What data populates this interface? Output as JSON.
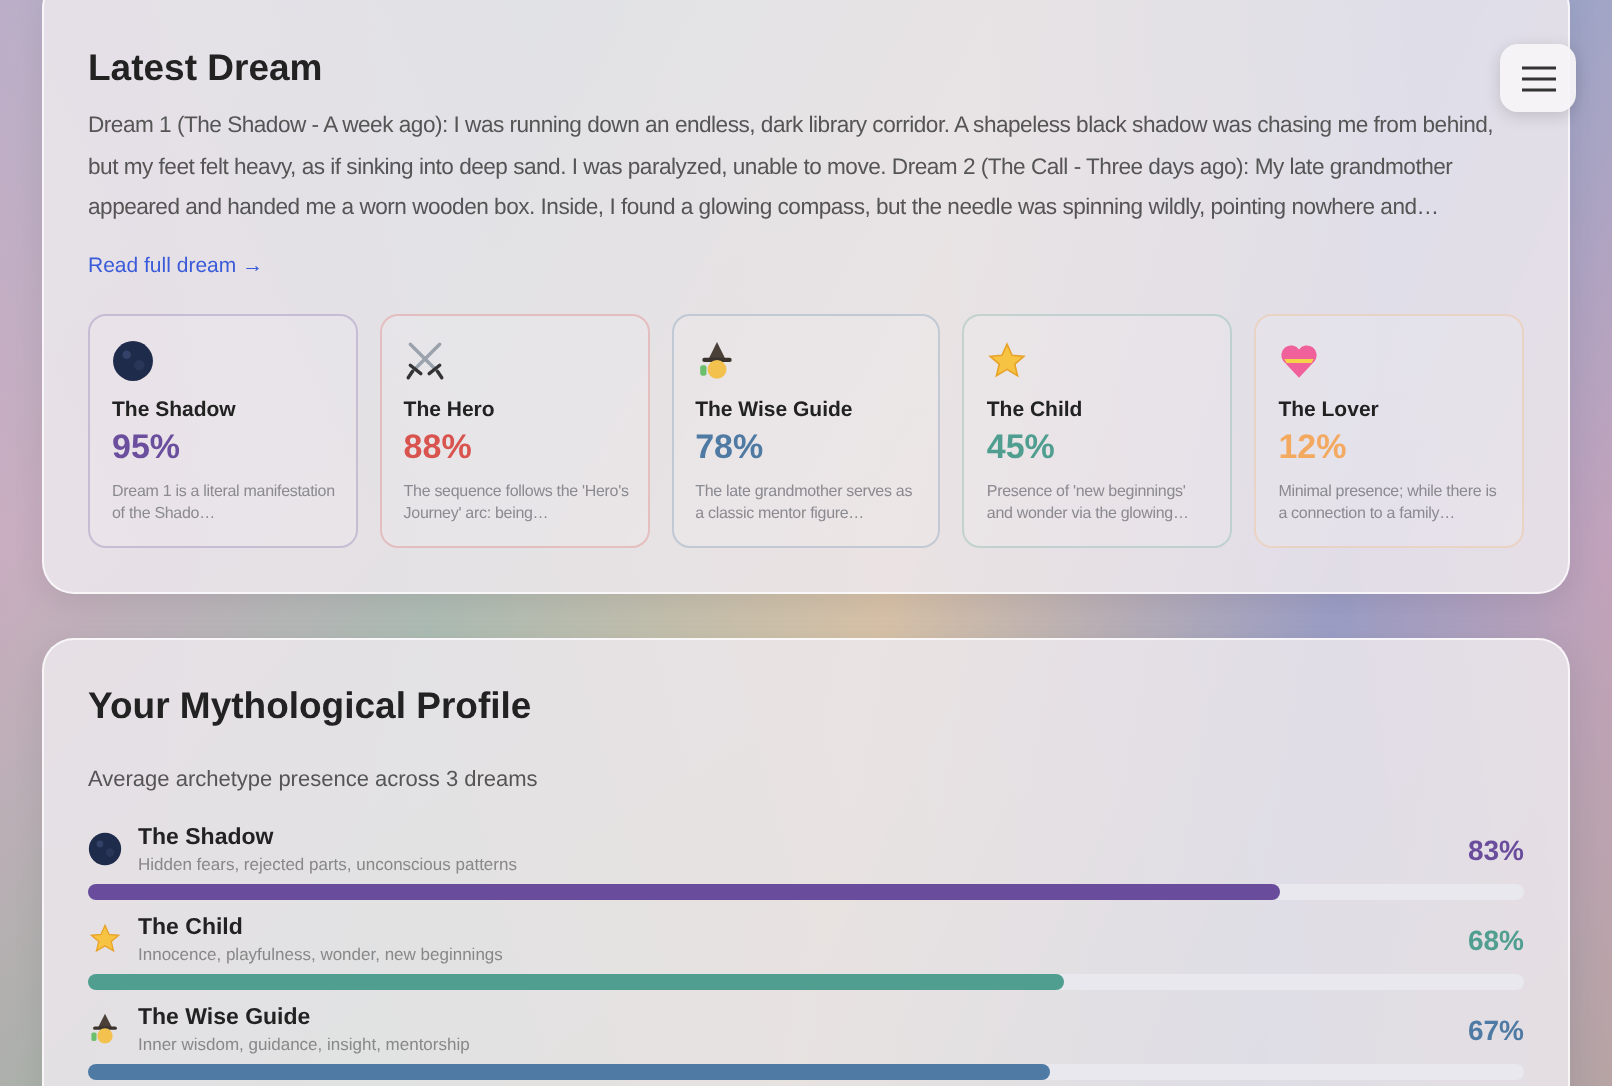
{
  "latest_dream": {
    "title": "Latest Dream",
    "text": "Dream 1 (The Shadow - A week ago): I was running down an endless, dark library corridor. A shapeless black shadow was chasing me from behind, but my feet felt heavy, as if sinking into deep sand. I was paralyzed, unable to move. Dream 2 (The Call - Three days ago): My late grandmother appeared and handed me a worn wooden box. Inside, I found a glowing compass, but the needle was spinning wildly, pointing nowhere and…",
    "link": "Read full dream →",
    "archetypes": [
      {
        "kind": "shadow",
        "name": "The Shadow",
        "percent": "95%",
        "color": "#6b4f9e",
        "note": "Dream 1 is a literal manifestation of the Shado…"
      },
      {
        "kind": "hero",
        "name": "The Hero",
        "percent": "88%",
        "color": "#d9534f",
        "note": "The sequence follows the 'Hero's Journey' arc: being…"
      },
      {
        "kind": "guide",
        "name": "The Wise Guide",
        "percent": "78%",
        "color": "#4f7aa3",
        "note": "The late grandmother serves as a classic mentor figure…"
      },
      {
        "kind": "child",
        "name": "The Child",
        "percent": "45%",
        "color": "#4f9e8f",
        "note": "Presence of 'new beginnings' and wonder via the glowing…"
      },
      {
        "kind": "lover",
        "name": "The Lover",
        "percent": "12%",
        "color": "#f4a960",
        "note": "Minimal presence; while there is a connection to a family…"
      }
    ]
  },
  "profile": {
    "title": "Your Mythological Profile",
    "subtitle": "Average archetype presence across 3 dreams",
    "rows": [
      {
        "kind": "shadow",
        "name": "The Shadow",
        "description": "Hidden fears, rejected parts, unconscious patterns",
        "percent": "83%",
        "level": 0.83,
        "color": "#6a4c9c"
      },
      {
        "kind": "child",
        "name": "The Child",
        "description": "Innocence, playfulness, wonder, new beginnings",
        "percent": "68%",
        "level": 0.68,
        "color": "#4f9e8f"
      },
      {
        "kind": "guide",
        "name": "The Wise Guide",
        "description": "Inner wisdom, guidance, insight, mentorship",
        "percent": "67%",
        "level": 0.67,
        "color": "#4f7aa3"
      }
    ]
  }
}
